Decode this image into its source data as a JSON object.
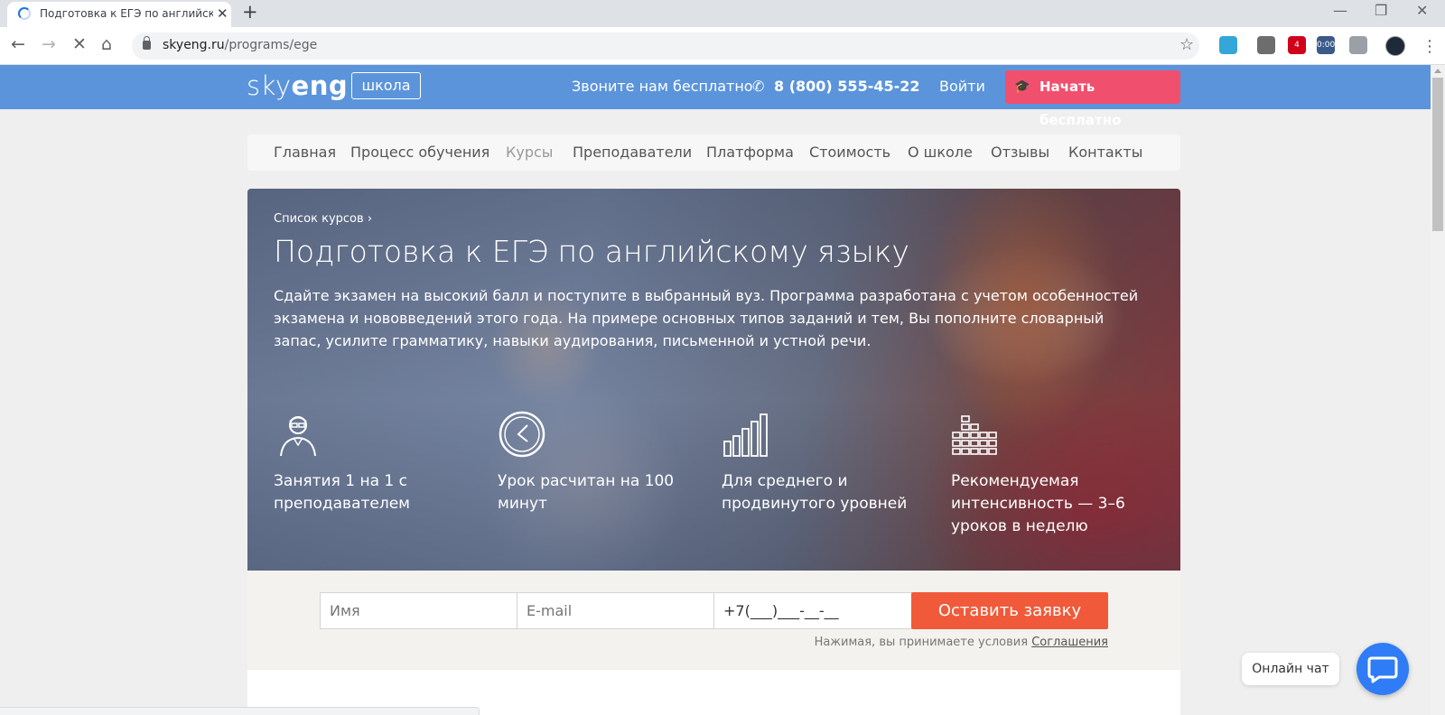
{
  "browser": {
    "tab_title": "Подготовка к ЕГЭ по английскому",
    "tab_close": "✕",
    "new_tab": "+",
    "url_host": "skyeng.ru",
    "url_path": "/programs/ege",
    "back_icon": "←",
    "forward_icon": "→",
    "stop_icon": "✕",
    "home_icon": "⌂",
    "star_icon": "☆",
    "menu_icon": "⋮",
    "minimize_icon": "—",
    "restore_icon": "❐",
    "close_icon": "✕",
    "extensions": [
      {
        "name": "bookmark-manager-icon",
        "label": "",
        "color": "#35a6d8"
      },
      {
        "name": "eyedropper-icon",
        "label": "",
        "color": "#6d6d6d"
      },
      {
        "name": "adblock-icon",
        "label": "4",
        "color": "#d0021b"
      },
      {
        "name": "share-timer-icon",
        "label": "0:00",
        "color": "#3a5a8a"
      },
      {
        "name": "profile-switcher-icon",
        "label": "",
        "color": "#9aa0a6"
      }
    ]
  },
  "site": {
    "logo_light": "sky",
    "logo_bold": "eng",
    "school_badge": "школа",
    "call_label": "Звоните нам бесплатно",
    "phone_icon": "✆",
    "phone": "8 (800) 555-45-22",
    "login": "Войти",
    "start_button": "Начать бесплатно",
    "start_icon": "🎓",
    "accent_color": "#5b94db",
    "cta_color": "#f0506e"
  },
  "nav": {
    "items": [
      {
        "label": "Главная",
        "active": false
      },
      {
        "label": "Процесс обучения",
        "active": false
      },
      {
        "label": "Курсы",
        "active": true
      },
      {
        "label": "Преподаватели",
        "active": false
      },
      {
        "label": "Платформа",
        "active": false
      },
      {
        "label": "Стоимость",
        "active": false
      },
      {
        "label": "О школе",
        "active": false
      },
      {
        "label": "Отзывы",
        "active": false
      },
      {
        "label": "Контакты",
        "active": false
      }
    ]
  },
  "hero": {
    "breadcrumb": "Список курсов",
    "breadcrumb_chevron": "›",
    "title": "Подготовка к ЕГЭ по английскому языку",
    "description": "Сдайте экзамен на высокий балл и поступите в выбранный вуз. Программа разработана с учетом особенностей экзамена и нововведений этого года. На примере основных типов заданий и тем, Вы пополните словарный запас, усилите грамматику, навыки аудирования, письменной и устной речи.",
    "features": [
      {
        "icon": "teacher-icon",
        "text": "Занятия 1 на 1 с преподавателем"
      },
      {
        "icon": "clock-icon",
        "text": "Урок расчитан на 100 минут"
      },
      {
        "icon": "level-bars-icon",
        "text": "Для среднего и продвинутого уровней"
      },
      {
        "icon": "intensity-grid-icon",
        "text": "Рекомендуемая интенсивность — 3–6 уроков в неделю"
      }
    ]
  },
  "form": {
    "name_placeholder": "Имя",
    "email_placeholder": "E-mail",
    "phone_value": "+7(___)___-__-__",
    "submit": "Оставить заявку",
    "agree_text": "Нажимая, вы принимаете условия",
    "agree_link": "Соглашения",
    "submit_color": "#f05a3a"
  },
  "chat": {
    "label": "Онлайн чат",
    "color": "#2f7cf6"
  }
}
